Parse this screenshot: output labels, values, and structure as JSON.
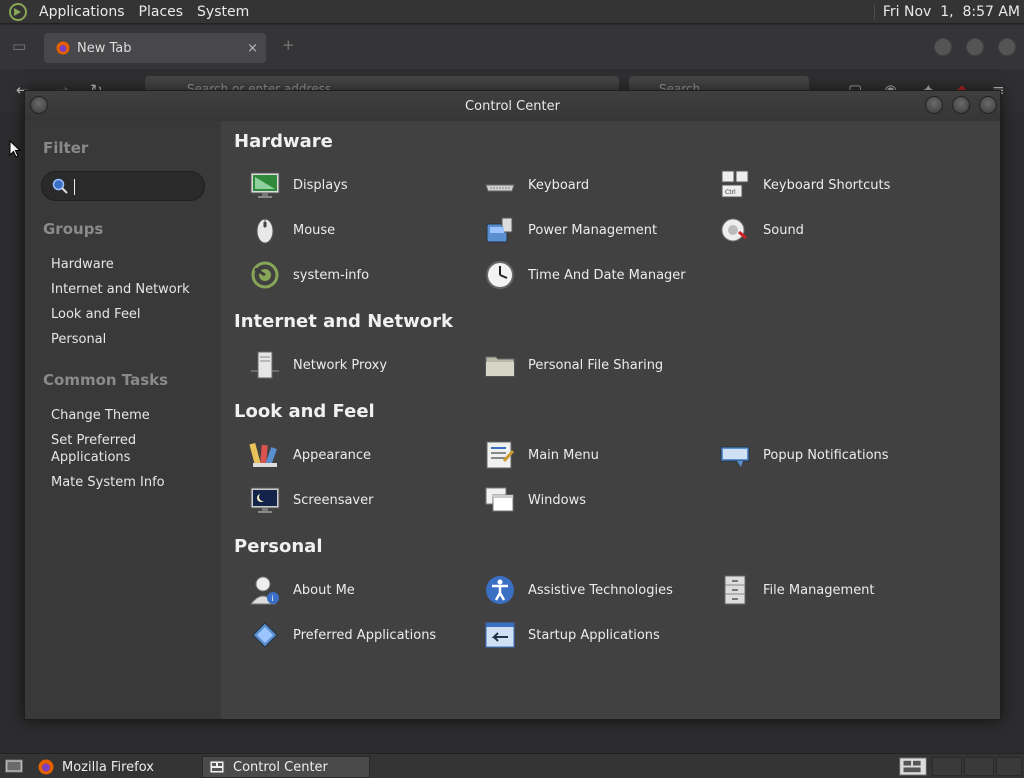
{
  "top_panel": {
    "menus": [
      "Applications",
      "Places",
      "System"
    ],
    "clock": "Fri Nov  1,  8:57 AM"
  },
  "firefox": {
    "tab_title": "New Tab",
    "tab_close": "×",
    "url_placeholder": "Search or enter address",
    "search_placeholder": "Search"
  },
  "control_center": {
    "title": "Control Center",
    "sidebar": {
      "filter_heading": "Filter",
      "filter_value": "",
      "groups_heading": "Groups",
      "groups": [
        "Hardware",
        "Internet and Network",
        "Look and Feel",
        "Personal"
      ],
      "tasks_heading": "Common Tasks",
      "tasks": [
        "Change Theme",
        "Set Preferred\nApplications",
        "Mate System Info"
      ]
    },
    "sections": [
      {
        "title": "Hardware",
        "items": [
          "Displays",
          "Keyboard",
          "Keyboard Shortcuts",
          "Mouse",
          "Power Management",
          "Sound",
          "system-info",
          "Time And Date Manager"
        ]
      },
      {
        "title": "Internet and Network",
        "items": [
          "Network Proxy",
          "Personal File Sharing"
        ]
      },
      {
        "title": "Look and Feel",
        "items": [
          "Appearance",
          "Main Menu",
          "Popup Notifications",
          "Screensaver",
          "Windows"
        ]
      },
      {
        "title": "Personal",
        "items": [
          "About Me",
          "Assistive Technologies",
          "File Management",
          "Preferred Applications",
          "Startup Applications"
        ]
      }
    ]
  },
  "taskbar": {
    "tasks": [
      "Mozilla Firefox",
      "Control Center"
    ]
  },
  "colors": {
    "panel": "#343434",
    "dialog_bg": "#414141",
    "sidebar_bg": "#393939",
    "mate_green": "#87a556"
  }
}
